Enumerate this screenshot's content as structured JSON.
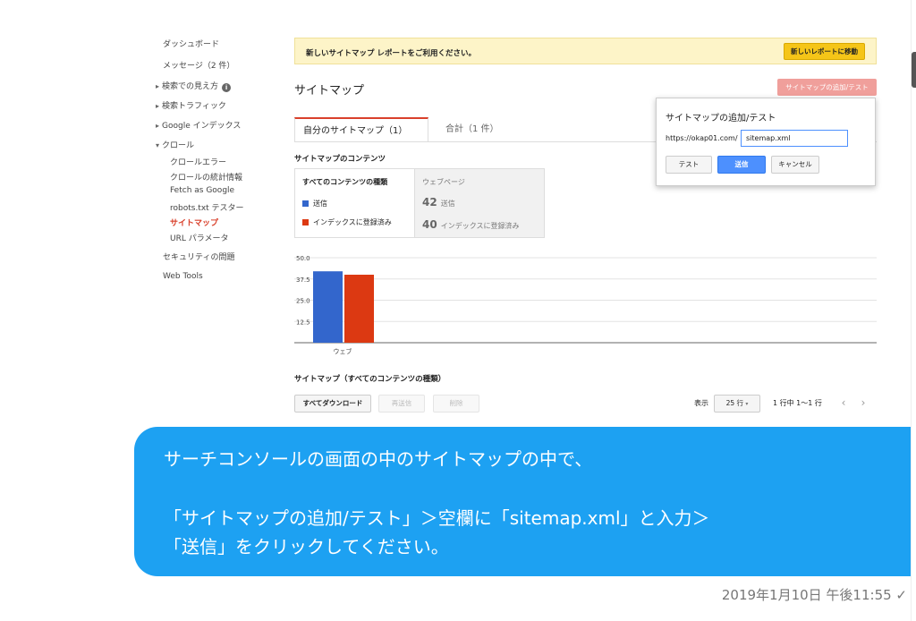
{
  "sidebar": {
    "dashboard": "ダッシュボード",
    "messages": "メッセージ（2 件）",
    "search_appearance": "検索での見え方",
    "search_traffic": "検索トラフィック",
    "google_index": "Google インデックス",
    "crawl": "クロール",
    "crawl_errors": "クロールエラー",
    "crawl_stats": "クロールの統計情報",
    "fetch_as_google": "Fetch as Google",
    "robots_tester": "robots.txt テスター",
    "sitemaps": "サイトマップ",
    "url_params": "URL パラメータ",
    "security": "セキュリティの問題",
    "web_tools": "Web Tools"
  },
  "banner": {
    "text": "新しいサイトマップ レポートをご利用ください。",
    "button": "新しいレポートに移動"
  },
  "page": {
    "title": "サイトマップ",
    "add_test_button": "サイトマップの追加/テスト"
  },
  "tabs": {
    "my_sitemaps": "自分のサイトマップ（1）",
    "total": "合計（1 件）"
  },
  "contents": {
    "title": "サイトマップのコンテンツ",
    "all_types": "すべてのコンテンツの種類",
    "submitted": "送信",
    "indexed": "インデックスに登録済み",
    "web_pages": "ウェブページ",
    "submitted_count": "42",
    "submitted_label": "送信",
    "indexed_count": "40",
    "indexed_label": "インデックスに登録済み"
  },
  "chart_data": {
    "type": "bar",
    "categories": [
      "ウェブ"
    ],
    "series": [
      {
        "name": "送信",
        "values": [
          42
        ],
        "color": "#3366cc"
      },
      {
        "name": "インデックスに登録済み",
        "values": [
          40
        ],
        "color": "#dc3912"
      }
    ],
    "yticks": [
      "50.0",
      "37.5",
      "25.0",
      "12.5"
    ],
    "ylim": [
      0,
      50
    ],
    "grid": true
  },
  "list": {
    "title": "サイトマップ（すべてのコンテンツの種類）",
    "download_all": "すべてダウンロード",
    "resubmit": "再送信",
    "delete": "削除",
    "display_label": "表示",
    "rows_select": "25 行",
    "range": "1 行中 1〜1 行"
  },
  "popup": {
    "title": "サイトマップの追加/テスト",
    "prefix": "https://okap01.com/",
    "input_value": "sitemap.xml",
    "test": "テスト",
    "submit": "送信",
    "cancel": "キャンセル"
  },
  "message": {
    "line1": "サーチコンソールの画面の中のサイトマップの中で、",
    "line2": "「サイトマップの追加/テスト」＞空欄に「sitemap.xml」と入力＞",
    "line3": "「送信」をクリックしてください。",
    "timestamp": "2019年1月10日 午後11:55 ✓"
  }
}
